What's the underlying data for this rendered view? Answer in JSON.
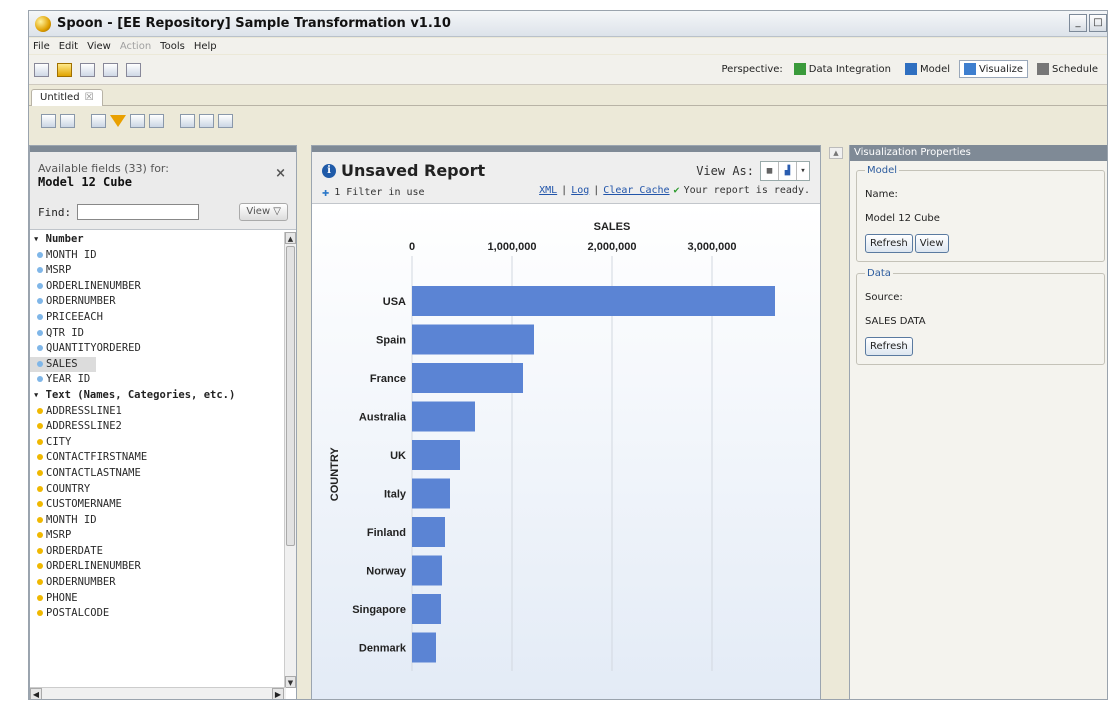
{
  "window": {
    "title": "Spoon - [EE Repository] Sample Transformation v1.10"
  },
  "menu": [
    {
      "label": "File",
      "disabled": false
    },
    {
      "label": "Edit",
      "disabled": false
    },
    {
      "label": "View",
      "disabled": false
    },
    {
      "label": "Action",
      "disabled": true
    },
    {
      "label": "Tools",
      "disabled": false
    },
    {
      "label": "Help",
      "disabled": false
    }
  ],
  "perspectives": {
    "label": "Perspective:",
    "items": [
      {
        "label": "Data Integration",
        "icon": "data-integration-icon",
        "color": "#3a9a3a",
        "active": false
      },
      {
        "label": "Model",
        "icon": "model-icon",
        "color": "#2f6fc0",
        "active": false
      },
      {
        "label": "Visualize",
        "icon": "visualize-icon",
        "color": "#3e7fcf",
        "active": true
      },
      {
        "label": "Schedule",
        "icon": "calendar-icon",
        "color": "#777777",
        "active": false
      }
    ]
  },
  "tab": {
    "label": "Untitled",
    "close": "☒"
  },
  "fields_panel": {
    "available": "Available fields (33) for:",
    "model": "Model 12 Cube",
    "close": "×",
    "find_label": "Find:",
    "find_value": "",
    "view_button": "View ▽",
    "groups": [
      {
        "label": "Number",
        "kind": "num",
        "fields": [
          "MONTH ID",
          "MSRP",
          "ORDERLINENUMBER",
          "ORDERNUMBER",
          "PRICEEACH",
          "QTR ID",
          "QUANTITYORDERED",
          "SALES",
          "YEAR ID"
        ]
      },
      {
        "label": "Text (Names, Categories, etc.)",
        "kind": "txt",
        "fields": [
          "ADDRESSLINE1",
          "ADDRESSLINE2",
          "CITY",
          "CONTACTFIRSTNAME",
          "CONTACTLASTNAME",
          "COUNTRY",
          "CUSTOMERNAME",
          "MONTH ID",
          "MSRP",
          "ORDERDATE",
          "ORDERLINENUMBER",
          "ORDERNUMBER",
          "PHONE",
          "POSTALCODE"
        ]
      }
    ],
    "selected_field": "SALES"
  },
  "report": {
    "title": "Unsaved Report",
    "view_as": "View As:",
    "filter_text": "1 Filter in use",
    "link_xml": "XML",
    "link_log": "Log",
    "link_clear_cache": "Clear Cache",
    "status": "Your report is ready."
  },
  "chart_data": {
    "type": "bar",
    "orientation": "horizontal",
    "xlabel": "SALES",
    "ylabel": "COUNTRY",
    "xticks": [
      0,
      1000000,
      2000000,
      3000000
    ],
    "xtick_labels": [
      "0",
      "1,000,000",
      "2,000,000",
      "3,000,000"
    ],
    "xlim": [
      0,
      4000000
    ],
    "categories": [
      "USA",
      "Spain",
      "France",
      "Australia",
      "UK",
      "Italy",
      "Finland",
      "Norway",
      "Singapore",
      "Denmark"
    ],
    "values": [
      3630000,
      1220000,
      1110000,
      630000,
      480000,
      380000,
      330000,
      300000,
      290000,
      240000
    ],
    "bar_color": "#5b84d4",
    "grid": "vertical"
  },
  "properties": {
    "header": "Visualization Properties",
    "model_group": "Model",
    "name_label": "Name:",
    "name_value": "Model 12 Cube",
    "refresh": "Refresh",
    "view": "View",
    "data_group": "Data",
    "source_label": "Source:",
    "source_value": "SALES DATA",
    "refresh2": "Refresh"
  }
}
